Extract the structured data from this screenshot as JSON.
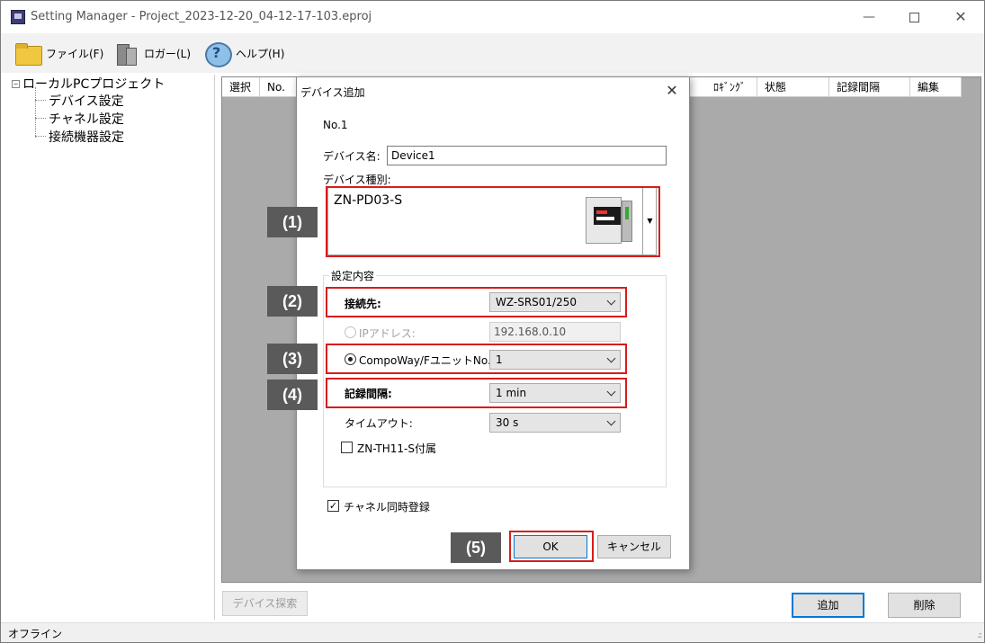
{
  "window": {
    "title": "Setting Manager - Project_2023-12-20_04-12-17-103.eproj",
    "min_glyph": "—",
    "close_glyph": "✕"
  },
  "menu": {
    "file": "ファイル(F)",
    "logger": "ロガー(L)",
    "help": "ヘルプ(H)"
  },
  "tree": {
    "root": "ローカルPCプロジェクト",
    "toggle": "−",
    "children": [
      "デバイス設定",
      "チャネル設定",
      "接続機器設定"
    ]
  },
  "grid": {
    "headers": {
      "select": "選択",
      "no": "No.",
      "logging": "ﾛｷﾞﾝｸﾞ",
      "status": "状態",
      "interval": "記録間隔",
      "edit": "編集"
    }
  },
  "buttons": {
    "device_search": "デバイス探索",
    "add": "追加",
    "delete": "削除"
  },
  "status": {
    "text": "オフライン",
    "grip": ".::"
  },
  "dialog": {
    "title": "デバイス追加",
    "close_glyph": "✕",
    "no_label": "No.1",
    "device_name_label": "デバイス名:",
    "device_name_value": "Device1",
    "device_type_label": "デバイス種別:",
    "device_type_value": "ZN-PD03-S",
    "dropdown_glyph": "▼",
    "group_title": "設定内容",
    "destination_label": "接続先:",
    "destination_value": "WZ-SRS01/250",
    "ip_label": "IPアドレス:",
    "ip_value": "192.168.0.10",
    "compo_label": "CompoWay/FユニットNo.:",
    "compo_value": "1",
    "interval_label": "記録間隔:",
    "interval_value": "1 min",
    "timeout_label": "タイムアウト:",
    "timeout_value": "30 s",
    "zn_label": "ZN-TH11-S付属",
    "ch_sim_label": "チャネル同時登録",
    "check_glyph": "✓",
    "ok": "OK",
    "cancel": "キャンセル"
  },
  "annotations": [
    "(1)",
    "(2)",
    "(3)",
    "(4)",
    "(5)"
  ],
  "colors": {
    "highlight": "#d81c1c",
    "tag_bg": "#5a5a5a",
    "accent": "#0078d7",
    "grid_bg": "#aaaaaa"
  }
}
